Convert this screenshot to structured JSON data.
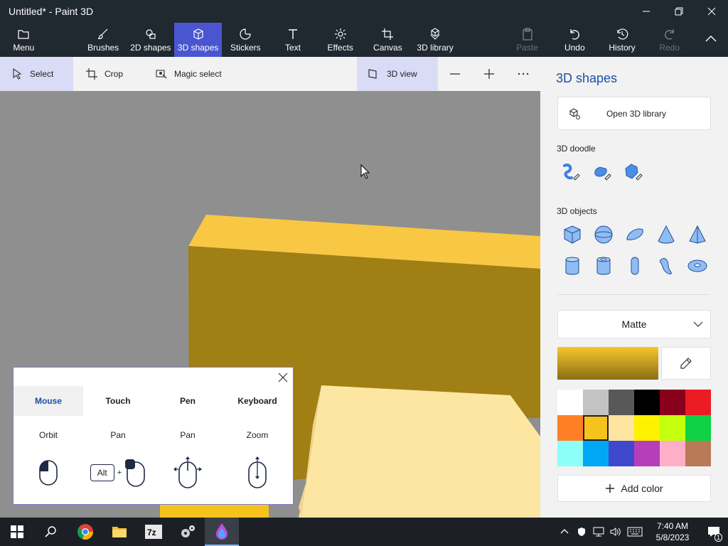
{
  "window": {
    "title": "Untitled* - Paint 3D"
  },
  "ribbon": {
    "menu": "Menu",
    "brushes": "Brushes",
    "shapes2d": "2D shapes",
    "shapes3d": "3D shapes",
    "stickers": "Stickers",
    "text": "Text",
    "effects": "Effects",
    "canvas": "Canvas",
    "library": "3D library",
    "paste": "Paste",
    "undo": "Undo",
    "history": "History",
    "redo": "Redo"
  },
  "toolbar": {
    "select": "Select",
    "crop": "Crop",
    "magic_select": "Magic select",
    "view_3d": "3D view"
  },
  "panel": {
    "title": "3D shapes",
    "open_library": "Open 3D library",
    "doodle_label": "3D doodle",
    "objects_label": "3D objects",
    "material": "Matte",
    "add_color": "Add color",
    "selected_color": "#f6c31c",
    "palette": [
      "#ffffff",
      "#c3c3c3",
      "#585858",
      "#000000",
      "#88001b",
      "#ec1c24",
      "#ff7f27",
      "#f6c31c",
      "#ffe4a0",
      "#fff200",
      "#c4ff0e",
      "#0ed145",
      "#8cfffb",
      "#00a8f3",
      "#3f48cc",
      "#b83dba",
      "#ffaec8",
      "#b97a57"
    ]
  },
  "help": {
    "tabs": [
      "Mouse",
      "Touch",
      "Pen",
      "Keyboard"
    ],
    "actions": [
      "Orbit",
      "Pan",
      "Pan",
      "Zoom"
    ],
    "alt_key": "Alt",
    "plus": "+"
  },
  "taskbar": {
    "time": "7:40 AM",
    "date": "5/8/2023",
    "notification_count": "1"
  }
}
